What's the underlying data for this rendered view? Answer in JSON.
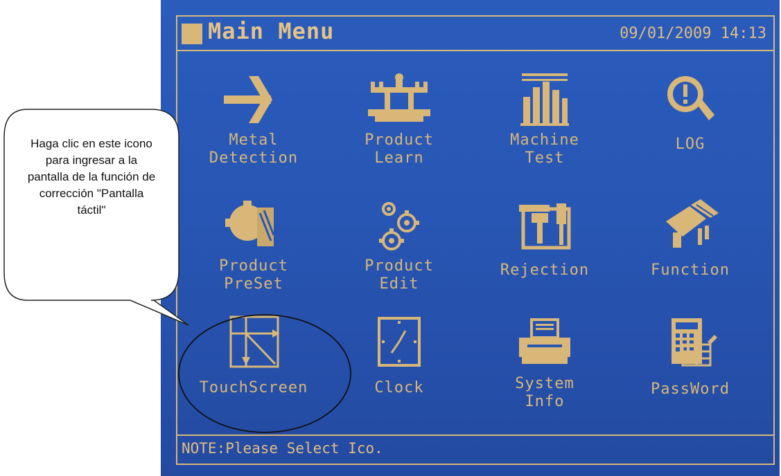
{
  "window": {
    "title": "Main Menu",
    "datetime": "09/01/2009 14:13"
  },
  "menu": [
    {
      "label": "Metal\nDetection",
      "icon": "metal-detection-icon"
    },
    {
      "label": "Product\nLearn",
      "icon": "product-learn-icon"
    },
    {
      "label": "Machine\nTest",
      "icon": "machine-test-icon"
    },
    {
      "label": "LOG",
      "icon": "log-search-icon"
    },
    {
      "label": "Product\nPreSet",
      "icon": "product-preset-icon"
    },
    {
      "label": "Product\nEdit",
      "icon": "product-edit-gears-icon"
    },
    {
      "label": "Rejection",
      "icon": "rejection-toolbox-icon"
    },
    {
      "label": "Function",
      "icon": "function-icon"
    },
    {
      "label": "TouchScreen",
      "icon": "touchscreen-calibration-icon"
    },
    {
      "label": "Clock",
      "icon": "clock-icon"
    },
    {
      "label": "System\nInfo",
      "icon": "printer-icon"
    },
    {
      "label": "PassWord",
      "icon": "password-calculator-icon"
    }
  ],
  "note": "NOTE:Please Select Ico.",
  "callout": {
    "text": "Haga clic en este icono para ingresar a la pantalla de la función de corrección \"Pantalla táctil\""
  },
  "colors": {
    "screen_bg": "#2856b4",
    "foreground": "#d8b779",
    "annotation": "#111111"
  }
}
